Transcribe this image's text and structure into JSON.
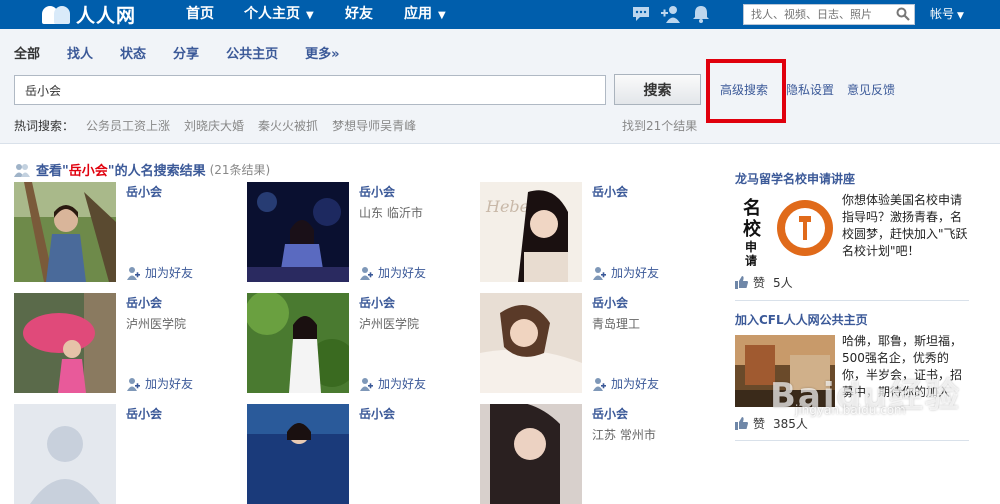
{
  "nav": {
    "logo_text": "人人网",
    "items": [
      {
        "label": "首页"
      },
      {
        "label": "个人主页"
      },
      {
        "label": "好友"
      },
      {
        "label": "应用"
      }
    ],
    "search_placeholder": "找人、视频、日志、照片",
    "account_label": "帐号",
    "icons": [
      "message-icon",
      "add-friend-icon",
      "notification-bell-icon",
      "search-icon"
    ]
  },
  "search": {
    "tabs": [
      {
        "label": "全部"
      },
      {
        "label": "找人"
      },
      {
        "label": "状态"
      },
      {
        "label": "分享"
      },
      {
        "label": "公共主页"
      },
      {
        "label": "更多»"
      }
    ],
    "query_value": "岳小会",
    "button_label": "搜索",
    "links": {
      "advanced": "高级搜索",
      "privacy": "隐私设置",
      "feedback": "意见反馈"
    },
    "hot_label": "热词搜索：",
    "hot_words": [
      "公务员工资上涨",
      "刘晓庆大婚",
      "秦火火被抓",
      "梦想导师吴青峰"
    ],
    "found_text": "找到21个结果"
  },
  "results": {
    "head_pre": "查看\"",
    "head_query": "岳小会",
    "head_post": "\"的人名搜索结果",
    "head_count": "(21条结果)",
    "add_friend_label": "加为好友",
    "people": [
      {
        "name": "岳小会",
        "info": "",
        "photo": "photo-girl-tree"
      },
      {
        "name": "岳小会",
        "info": "山东  临沂市",
        "photo": "photo-girl-night"
      },
      {
        "name": "岳小会",
        "info": "",
        "photo": "photo-girl-artistic"
      },
      {
        "name": "岳小会",
        "info": "泸州医学院",
        "photo": "photo-girl-umbrella"
      },
      {
        "name": "岳小会",
        "info": "泸州医学院",
        "photo": "photo-girl-garden"
      },
      {
        "name": "岳小会",
        "info": "青岛理工",
        "photo": "photo-girl-lying"
      },
      {
        "name": "岳小会",
        "info": "",
        "photo": "photo-default-avatar"
      },
      {
        "name": "岳小会",
        "info": "",
        "photo": "photo-girl-blue"
      },
      {
        "name": "岳小会",
        "info": "江苏  常州市",
        "photo": "photo-girl-portrait"
      }
    ]
  },
  "sidebar": {
    "ads": [
      {
        "title": "龙马留学名校申请讲座",
        "body": "你想体验美国名校申请指导吗？激扬青春，名校圆梦，赶快加入\"飞跃名校计划\"吧！",
        "likes": "5人",
        "like_label": "赞",
        "image_text": [
          "名",
          "校",
          "申",
          "请"
        ]
      },
      {
        "title": "加入CFL人人网公共主页",
        "body": "哈佛，耶鲁，斯坦福，500强名企，优秀的你，半岁会，证书，招募中，期待你的加入",
        "likes": "385人",
        "like_label": "赞"
      }
    ]
  },
  "watermark": {
    "text": "Baidu经验",
    "sub": "jingyan.baidu.com"
  }
}
